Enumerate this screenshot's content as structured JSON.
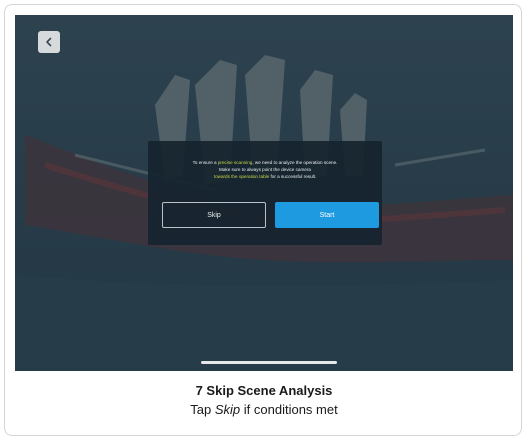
{
  "dialog": {
    "line1_pre": "To ensure a ",
    "line1_hl": "precise scanning",
    "line1_post": ", we need to analyze the operation scene.",
    "line2": "Make sure to always point the device camera",
    "line3_hl": "towards the operation table",
    "line3_post": " for a successful result.",
    "skip_label": "Skip",
    "start_label": "Start"
  },
  "caption": {
    "title": "7 Skip Scene Analysis",
    "sub_pre": "Tap ",
    "sub_em": "Skip",
    "sub_post": " if conditions met"
  },
  "colors": {
    "accent": "#1e9ae0",
    "highlight": "#c9d94a",
    "overlay": "#16242e"
  },
  "icons": {
    "back": "chevron-left-icon"
  }
}
